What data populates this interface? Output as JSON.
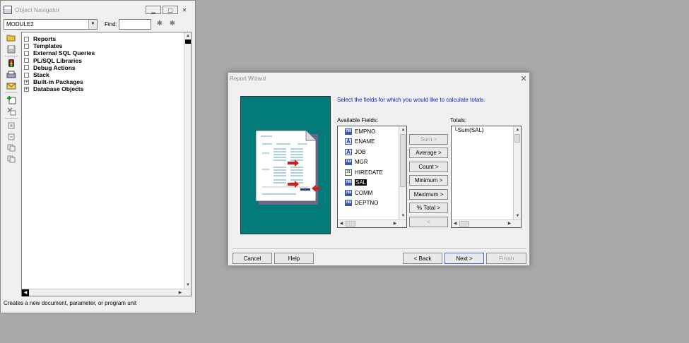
{
  "navigator": {
    "title": "Object Navigator",
    "module_value": "MODULE2",
    "find_label": "Find:",
    "tree_items": [
      {
        "label": "Reports",
        "expander": ""
      },
      {
        "label": "Templates",
        "expander": ""
      },
      {
        "label": "External SQL Queries",
        "expander": ""
      },
      {
        "label": "PL/SQL Libraries",
        "expander": ""
      },
      {
        "label": "Debug Actions",
        "expander": ""
      },
      {
        "label": "Stack",
        "expander": ""
      },
      {
        "label": "Built-in Packages",
        "expander": "+"
      },
      {
        "label": "Database Objects",
        "expander": "+"
      }
    ],
    "status_text": "Creates a new document, parameter, or program unit"
  },
  "wizard": {
    "title": "Report Wizard",
    "instruction": "Select the fields for which you would like to calculate totals.",
    "available_label": "Available Fields:",
    "totals_label": "Totals:",
    "available_fields": [
      {
        "name": "EMPNO",
        "icon": "number-field-icon",
        "glyph": "789"
      },
      {
        "name": "ENAME",
        "icon": "text-field-icon",
        "glyph": "A"
      },
      {
        "name": "JOB",
        "icon": "text-field-icon",
        "glyph": "A"
      },
      {
        "name": "MGR",
        "icon": "number-field-icon",
        "glyph": "789"
      },
      {
        "name": "HIREDATE",
        "icon": "date-field-icon",
        "glyph": "31"
      },
      {
        "name": "SAL",
        "icon": "number-field-icon",
        "glyph": "789"
      },
      {
        "name": "COMM",
        "icon": "number-field-icon",
        "glyph": "789"
      },
      {
        "name": "DEPTNO",
        "icon": "number-field-icon",
        "glyph": "789"
      }
    ],
    "selected_field": "SAL",
    "totals": [
      "Sum(SAL)"
    ],
    "buttons": {
      "sum": "Sum  >",
      "average": "Average >",
      "count": "Count  >",
      "minimum": "Minimum >",
      "maximum": "Maximum >",
      "pct_total": "% Total >",
      "remove": "<",
      "cancel": "Cancel",
      "help": "Help",
      "back": "< Back",
      "next": "Next >",
      "finish": "Finish"
    }
  },
  "colors": {
    "desktop": "#a9a9a9",
    "illustration_bg": "#037b7b",
    "instruction_text": "#1020a0",
    "selection": "#000000"
  }
}
